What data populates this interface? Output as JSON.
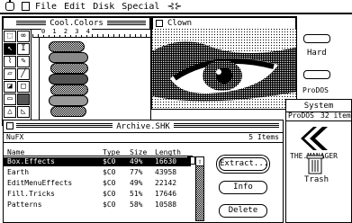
{
  "menubar": {
    "file": "File",
    "edit": "Edit",
    "disk": "Disk",
    "special": "Special"
  },
  "cool_colors": {
    "title": "Cool.Colors",
    "ruler": "0    1    2    3    4 "
  },
  "clown": {
    "title": "Clown"
  },
  "desktop": {
    "hard_label": "Hard",
    "prodos_label": "ProDOS",
    "trash_label": "Trash"
  },
  "system_window": {
    "title": "System",
    "volume": "ProDOS",
    "count": "32 item",
    "app_label": "THE.MANAGER"
  },
  "archive": {
    "title": "Archive.SHK",
    "subtitle": "NuFX",
    "item_count": "5 Items",
    "columns": {
      "name": "Name",
      "type": "Type",
      "size": "Size",
      "length": "Length"
    },
    "rows": [
      {
        "name": "Box.Effects",
        "type": "$C0",
        "size": "49%",
        "length": "16630"
      },
      {
        "name": "Earth",
        "type": "$C0",
        "size": "77%",
        "length": "43958"
      },
      {
        "name": "EditMenuEffects",
        "type": "$C0",
        "size": "49%",
        "length": "22142"
      },
      {
        "name": "Fill.Tricks",
        "type": "$C0",
        "size": "51%",
        "length": "17646"
      },
      {
        "name": "Patterns",
        "type": "$C0",
        "size": "58%",
        "length": "10588"
      }
    ],
    "buttons": {
      "extract": "Extract...",
      "info": "Info",
      "delete": "Delete"
    }
  }
}
